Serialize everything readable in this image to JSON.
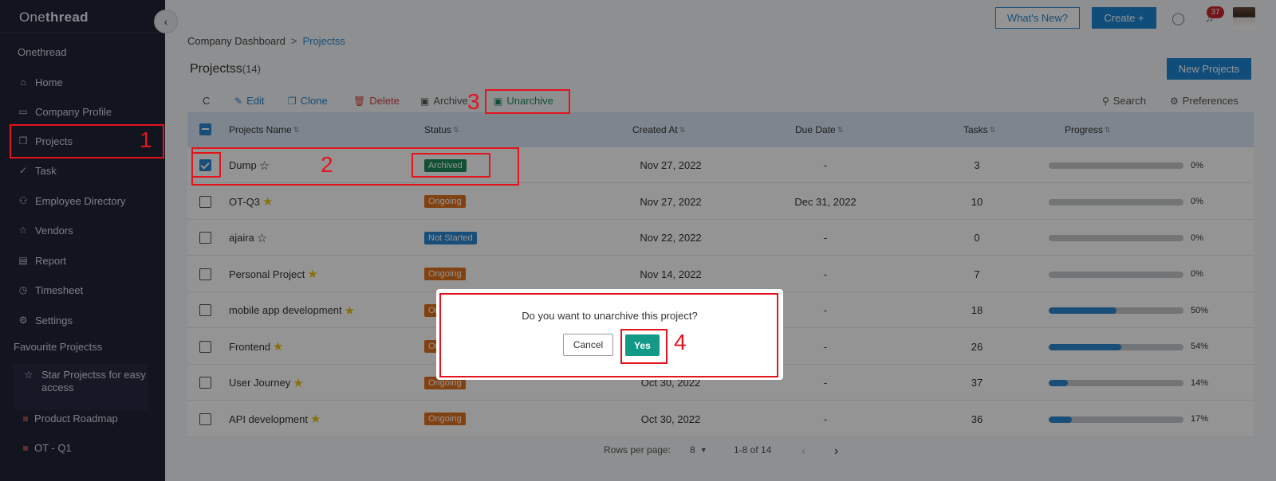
{
  "sidebar": {
    "logo_prefix": "One",
    "logo_suffix": "thread",
    "workspace": "Onethread",
    "items": [
      {
        "label": "Home",
        "icon": "⌂"
      },
      {
        "label": "Company Profile",
        "icon": "▭"
      },
      {
        "label": "Projects",
        "icon": "❐"
      },
      {
        "label": "Task",
        "icon": "✓"
      },
      {
        "label": "Employee Directory",
        "icon": "⚇"
      },
      {
        "label": "Vendors",
        "icon": "☆"
      },
      {
        "label": "Report",
        "icon": "▤"
      },
      {
        "label": "Timesheet",
        "icon": "◷"
      },
      {
        "label": "Settings",
        "icon": "⚙"
      }
    ],
    "favourites_title": "Favourite Projectss",
    "star_hint": "Star Projectss for easy access",
    "favourites": [
      "Product Roadmap",
      "OT - Q1"
    ]
  },
  "topbar": {
    "whats_new": "What's New?",
    "create": "Create +",
    "notification_count": "37"
  },
  "breadcrumb": {
    "root": "Company Dashboard",
    "sep": ">",
    "current": "Projectss"
  },
  "page": {
    "title": "Projectss",
    "count": "(14)",
    "new_button": "New Projects"
  },
  "toolbar": {
    "refresh": "C",
    "edit": "Edit",
    "clone": "Clone",
    "delete": "Delete",
    "archive": "Archive",
    "unarchive": "Unarchive",
    "search": "Search",
    "preferences": "Preferences"
  },
  "table": {
    "columns": [
      "Projects Name",
      "Status",
      "Created At",
      "Due Date",
      "Tasks",
      "Progress"
    ],
    "rows": [
      {
        "name": "Dump",
        "starred": false,
        "status": "Archived",
        "status_color": "#1e8a5a",
        "created": "Nov 27, 2022",
        "due": "-",
        "tasks": "3",
        "progress": 0,
        "progress_label": "0%",
        "checked": true
      },
      {
        "name": "OT-Q3",
        "starred": true,
        "status": "Ongoing",
        "status_color": "#e0701d",
        "created": "Nov 27, 2022",
        "due": "Dec 31, 2022",
        "tasks": "10",
        "progress": 0,
        "progress_label": "0%",
        "checked": false
      },
      {
        "name": "ajaira",
        "starred": false,
        "status": "Not Started",
        "status_color": "#2a87cf",
        "created": "Nov 22, 2022",
        "due": "-",
        "tasks": "0",
        "progress": 0,
        "progress_label": "0%",
        "checked": false
      },
      {
        "name": "Personal Project",
        "starred": true,
        "status": "Ongoing",
        "status_color": "#e0701d",
        "created": "Nov 14, 2022",
        "due": "-",
        "tasks": "7",
        "progress": 0,
        "progress_label": "0%",
        "checked": false
      },
      {
        "name": "mobile app development",
        "starred": true,
        "status": "Ongoing",
        "status_color": "#e0701d",
        "created": "",
        "due": "-",
        "tasks": "18",
        "progress": 50,
        "progress_label": "50%",
        "checked": false
      },
      {
        "name": "Frontend",
        "starred": true,
        "status": "Ongoing",
        "status_color": "#e0701d",
        "created": "",
        "due": "-",
        "tasks": "26",
        "progress": 54,
        "progress_label": "54%",
        "checked": false
      },
      {
        "name": "User Journey",
        "starred": true,
        "status": "Ongoing",
        "status_color": "#e0701d",
        "created": "Oct 30, 2022",
        "due": "-",
        "tasks": "37",
        "progress": 14,
        "progress_label": "14%",
        "checked": false
      },
      {
        "name": "API development",
        "starred": true,
        "status": "Ongoing",
        "status_color": "#e0701d",
        "created": "Oct 30, 2022",
        "due": "-",
        "tasks": "36",
        "progress": 17,
        "progress_label": "17%",
        "checked": false
      }
    ]
  },
  "pagination": {
    "rows_label": "Rows per page:",
    "rows_value": "8",
    "range": "1-8 of 14"
  },
  "modal": {
    "message": "Do you want to unarchive this project?",
    "cancel": "Cancel",
    "confirm": "Yes"
  },
  "annotations": [
    "1",
    "2",
    "3",
    "4"
  ]
}
